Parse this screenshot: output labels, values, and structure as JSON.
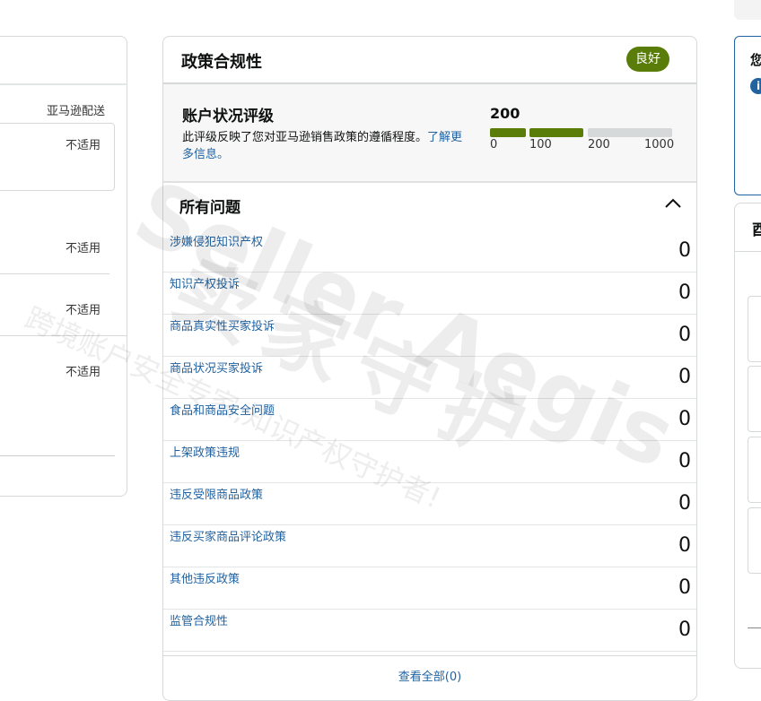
{
  "left": {
    "header_label": "亚马逊配送",
    "rows": [
      "不适用",
      "不适用",
      "不适用",
      "不适用"
    ]
  },
  "policy": {
    "title": "政策合规性",
    "status_badge": "良好",
    "rating": {
      "title": "账户状况评级",
      "description": "此评级反映了您对亚马逊销售政策的遵循程度。",
      "learn_more": "了解更多信息。",
      "score": "200",
      "ticks": [
        "0",
        "100",
        "200",
        "1000"
      ],
      "fill_fraction": 0.2,
      "colors": {
        "good": "#5a7d0a",
        "empty": "#d5d9d9"
      }
    },
    "issues_title": "所有问题",
    "issues": [
      {
        "label": "涉嫌侵犯知识产权",
        "count": "0"
      },
      {
        "label": "知识产权投诉",
        "count": "0"
      },
      {
        "label": "商品真实性买家投诉",
        "count": "0"
      },
      {
        "label": "商品状况买家投诉",
        "count": "0"
      },
      {
        "label": "食品和商品安全问题",
        "count": "0"
      },
      {
        "label": "上架政策违规",
        "count": "0"
      },
      {
        "label": "违反受限商品政策",
        "count": "0"
      },
      {
        "label": "违反买家商品评论政策",
        "count": "0"
      },
      {
        "label": "其他违反政策",
        "count": "0"
      },
      {
        "label": "监管合规性",
        "count": "0"
      }
    ],
    "view_all": "查看全部(0)"
  },
  "right": {
    "card1_text": "您",
    "card2_text": "酉"
  },
  "watermark": {
    "brand": "Seller Aegis",
    "cn": "卖家守护",
    "slogan": "跨境账户安全专家,知识产权守护者!"
  }
}
